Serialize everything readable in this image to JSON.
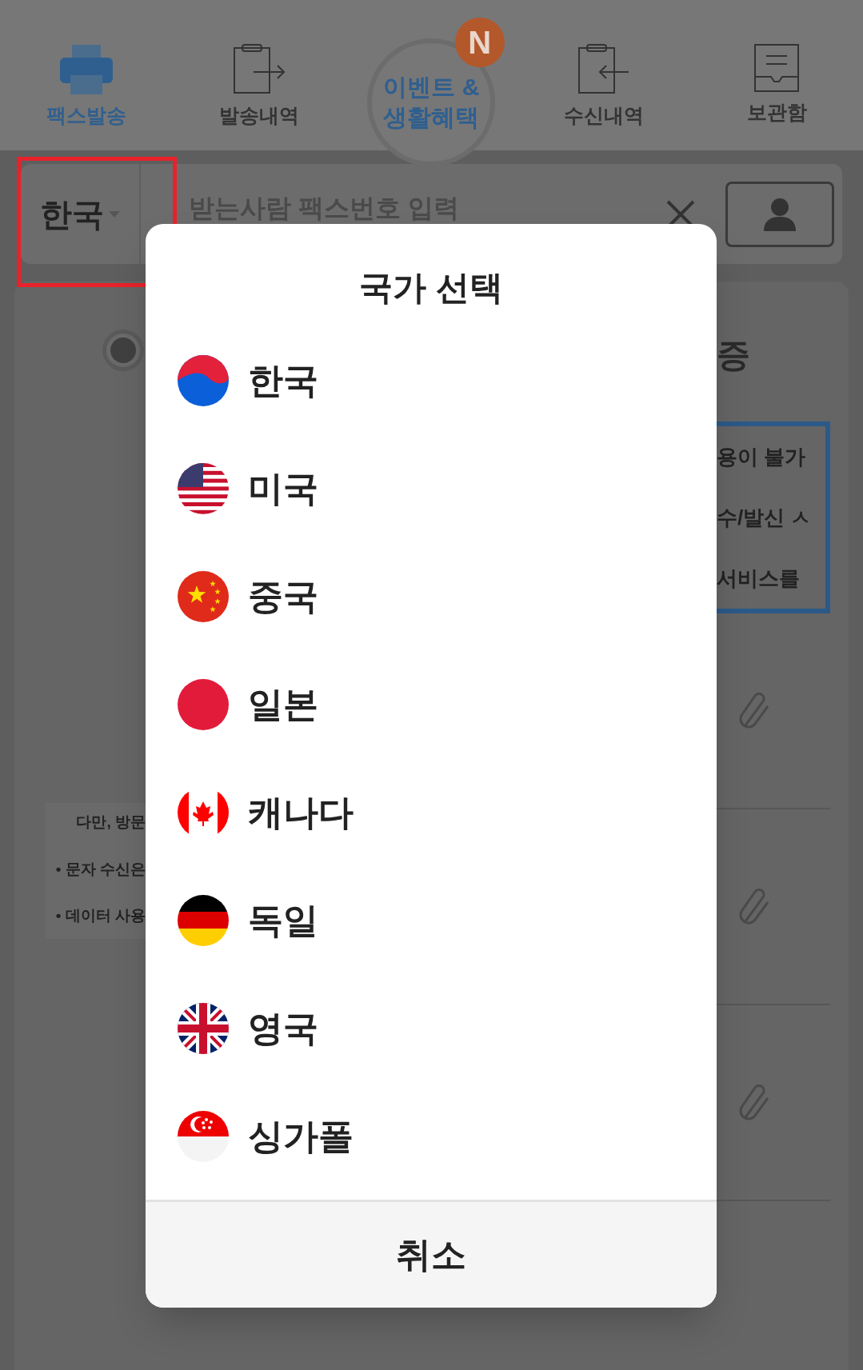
{
  "nav": {
    "items": [
      {
        "kind": "tab",
        "label": "팩스발송",
        "selected": true
      },
      {
        "kind": "tab",
        "label": "발송내역",
        "selected": false
      },
      {
        "kind": "event",
        "line1": "이벤트 &",
        "line2": "생활혜택",
        "badge": "N"
      },
      {
        "kind": "tab",
        "label": "수신내역",
        "selected": false
      },
      {
        "kind": "tab",
        "label": "보관함",
        "selected": false
      }
    ]
  },
  "search": {
    "country": "한국",
    "placeholder": "받는사람 팩스번호 입력"
  },
  "content": {
    "radio": {
      "selected": true
    },
    "heading_fragment": "증",
    "notice_lines": [
      "용이 불가",
      "수/발신 ㅅ",
      "서비스를"
    ],
    "left_lines": [
      "다만, 방문",
      "• 문자 수신은",
      "• 데이터 사용"
    ]
  },
  "dialog": {
    "title": "국가 선택",
    "countries": [
      {
        "name": "한국"
      },
      {
        "name": "미국"
      },
      {
        "name": "중국"
      },
      {
        "name": "일본"
      },
      {
        "name": "캐나다"
      },
      {
        "name": "독일"
      },
      {
        "name": "영국"
      },
      {
        "name": "싱가폴"
      }
    ],
    "cancel": "취소"
  }
}
